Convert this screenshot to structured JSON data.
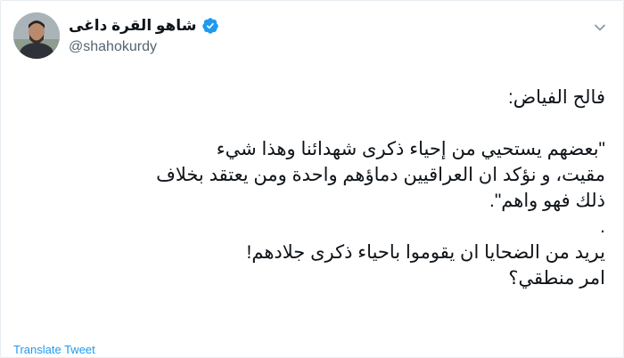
{
  "user": {
    "display_name": "شاهو القرة داغى",
    "handle": "@shahokurdy",
    "verified": true
  },
  "tweet": {
    "lines": [
      "فالح الفياض:",
      "",
      "\"بعضهم يستحيي من إحياء ذكرى شهدائنا وهذا شيء",
      "مقيت، و نؤكد ان العراقيين دماؤهم واحدة ومن يعتقد بخلاف",
      "ذلك فهو واهم\".",
      ".",
      "يريد من الضحايا ان يقوموا باحياء ذكرى جلادهم!",
      "امر منطقي؟"
    ]
  },
  "actions": {
    "translate_label": "Translate Tweet"
  },
  "icons": {
    "verified": "verified-badge-icon",
    "more": "chevron-down-icon"
  },
  "colors": {
    "accent": "#1d9bf0",
    "text": "#0f1419",
    "muted": "#536471"
  }
}
